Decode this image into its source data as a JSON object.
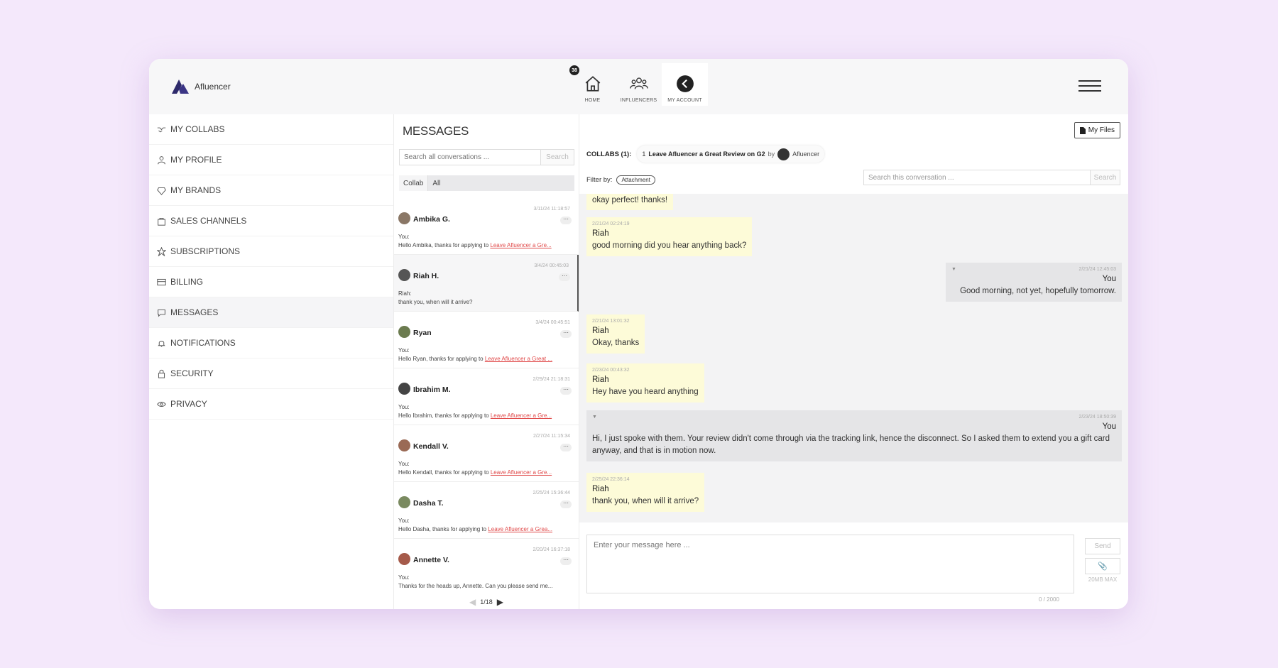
{
  "app": {
    "name": "Afluencer"
  },
  "nav": {
    "items": [
      {
        "label": "HOME",
        "icon": "home-icon",
        "badge": "38"
      },
      {
        "label": "INFLUENCERS",
        "icon": "people-icon"
      },
      {
        "label": "MY ACCOUNT",
        "icon": "back-circle-icon"
      }
    ]
  },
  "sidebar": {
    "items": [
      {
        "label": "MY COLLABS",
        "icon": "handshake-icon"
      },
      {
        "label": "MY PROFILE",
        "icon": "user-icon"
      },
      {
        "label": "MY BRANDS",
        "icon": "diamond-icon"
      },
      {
        "label": "SALES CHANNELS",
        "icon": "bag-icon"
      },
      {
        "label": "SUBSCRIPTIONS",
        "icon": "star-icon"
      },
      {
        "label": "BILLING",
        "icon": "card-icon"
      },
      {
        "label": "MESSAGES",
        "icon": "chat-icon"
      },
      {
        "label": "NOTIFICATIONS",
        "icon": "bell-icon"
      },
      {
        "label": "SECURITY",
        "icon": "lock-icon"
      },
      {
        "label": "PRIVACY",
        "icon": "eye-icon"
      }
    ]
  },
  "conversations": {
    "title": "MESSAGES",
    "search_placeholder": "Search all conversations ...",
    "search_button": "Search",
    "filter_collab": "Collab",
    "filter_all": "All",
    "items": [
      {
        "name": "Ambika G.",
        "time": "3/11/24 11:18:57",
        "from": "You:",
        "preview": "Hello Ambika, thanks for applying to ",
        "link": "Leave Afluencer a Gre..."
      },
      {
        "name": "Riah H.",
        "time": "3/4/24 00:45:03",
        "from": "Riah:",
        "preview": "thank you, when will it arrive?",
        "link": ""
      },
      {
        "name": "Ryan",
        "time": "3/4/24 00:45:51",
        "from": "You:",
        "preview": "Hello Ryan, thanks for applying to ",
        "link": "Leave Afluencer a Great ..."
      },
      {
        "name": "Ibrahim M.",
        "time": "2/29/24 21:18:31",
        "from": "You:",
        "preview": "Hello Ibrahim, thanks for applying to ",
        "link": "Leave Afluencer a Gre..."
      },
      {
        "name": "Kendall V.",
        "time": "2/27/24 11:15:34",
        "from": "You:",
        "preview": "Hello Kendall, thanks for applying to ",
        "link": "Leave Afluencer a Gre..."
      },
      {
        "name": "Dasha T.",
        "time": "2/25/24 15:36:44",
        "from": "You:",
        "preview": "Hello Dasha, thanks for applying to ",
        "link": "Leave Afluencer a Grea..."
      },
      {
        "name": "Annette V.",
        "time": "2/20/24 16:37:18",
        "from": "You:",
        "preview": "Thanks for the heads up, Annette. Can you please send me...",
        "link": ""
      }
    ],
    "page": "1/18"
  },
  "chat": {
    "my_files": "My Files",
    "collabs_label": "COLLABS (1):",
    "collab_index": "1",
    "collab_title": "Leave Afluencer a Great Review on G2",
    "collab_by": "by",
    "collab_brand": "Afluencer",
    "filter_label": "Filter by:",
    "filter_tag": "Attachment",
    "search_placeholder": "Search this conversation ...",
    "search_button": "Search",
    "messages": [
      {
        "side": "them",
        "ts": "",
        "who": "",
        "text": "okay perfect! thanks!"
      },
      {
        "side": "them",
        "ts": "2/21/24 02:24:19",
        "who": "Riah",
        "text": "good morning did you hear anything back?"
      },
      {
        "side": "me",
        "ts": "2/21/24 12:45:03",
        "who": "You",
        "text": "Good morning, not yet, hopefully tomorrow."
      },
      {
        "side": "them",
        "ts": "2/21/24 13:01:32",
        "who": "Riah",
        "text": "Okay, thanks"
      },
      {
        "side": "them",
        "ts": "2/23/24 00:43:32",
        "who": "Riah",
        "text": "Hey have you heard anything"
      },
      {
        "side": "me",
        "ts": "2/23/24 18:50:39",
        "who": "You",
        "text": "Hi, I just spoke with them. Your review didn't come through via the tracking link, hence the disconnect. So I asked them to extend you a gift card anyway, and that is in motion now."
      },
      {
        "side": "them",
        "ts": "2/25/24 22:36:14",
        "who": "Riah",
        "text": "thank you, when will it arrive?"
      }
    ],
    "composer_placeholder": "Enter your message here ...",
    "send": "Send",
    "max_size": "20MB MAX",
    "char_count": "0 / 2000"
  }
}
